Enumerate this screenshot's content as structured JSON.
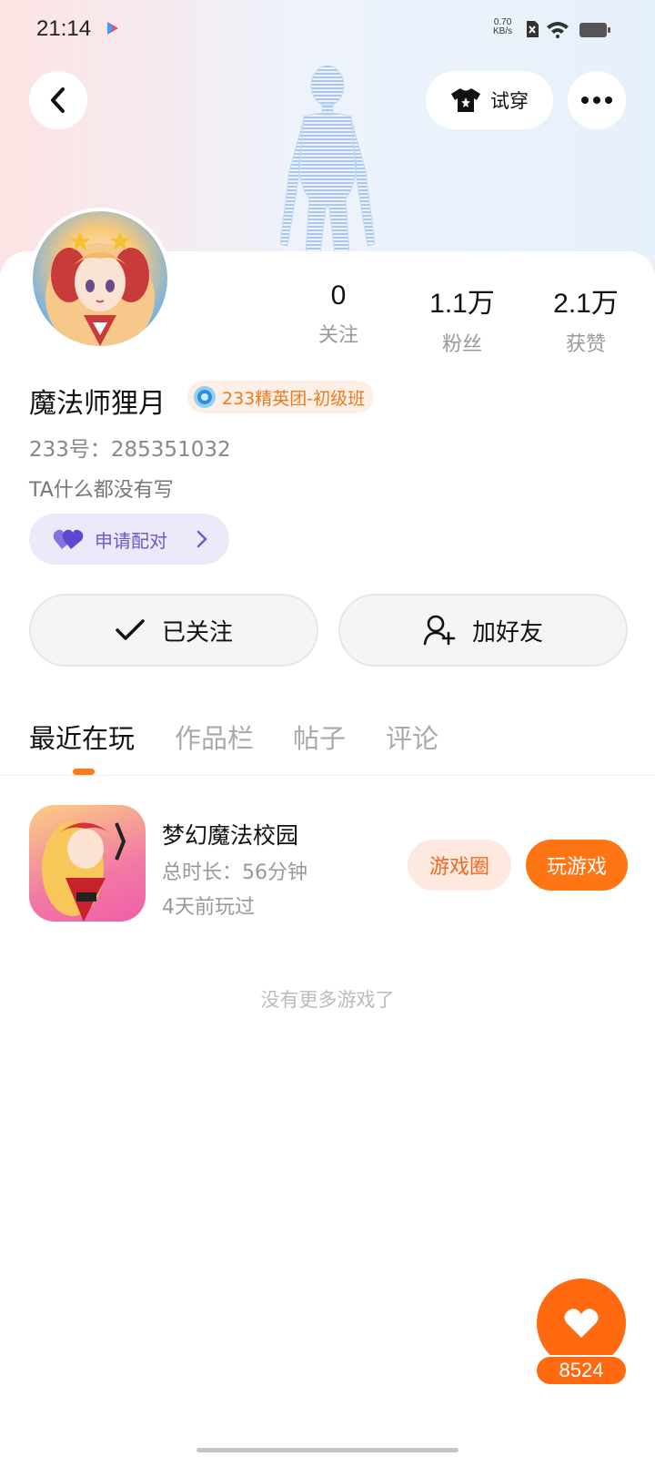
{
  "status_bar": {
    "time": "21:14",
    "net_speed": "0.70",
    "net_unit": "KB/s"
  },
  "header": {
    "try_on_label": "试穿"
  },
  "profile": {
    "stats": [
      {
        "value": "0",
        "label": "关注"
      },
      {
        "value": "1.1万",
        "label": "粉丝"
      },
      {
        "value": "2.1万",
        "label": "获赞"
      }
    ],
    "username": "魔法师狸月",
    "badge": "233精英团-初级班",
    "uid": "233号：285351032",
    "bio": "TA什么都没有写",
    "pair_label": "申请配对"
  },
  "actions": {
    "follow_label": "已关注",
    "add_friend_label": "加好友"
  },
  "tabs": [
    {
      "label": "最近在玩",
      "active": true
    },
    {
      "label": "作品栏",
      "active": false
    },
    {
      "label": "帖子",
      "active": false
    },
    {
      "label": "评论",
      "active": false
    }
  ],
  "games": [
    {
      "title": "梦幻魔法校园",
      "duration": "总时长：56分钟",
      "last_played": "4天前玩过",
      "circle_label": "游戏圈",
      "play_label": "玩游戏"
    }
  ],
  "empty_hint": "没有更多游戏了",
  "fab": {
    "count": "8524"
  },
  "colors": {
    "accent": "#ff7514",
    "pair_purple": "#6a5bd2",
    "badge_orange": "#ea7b1e"
  }
}
